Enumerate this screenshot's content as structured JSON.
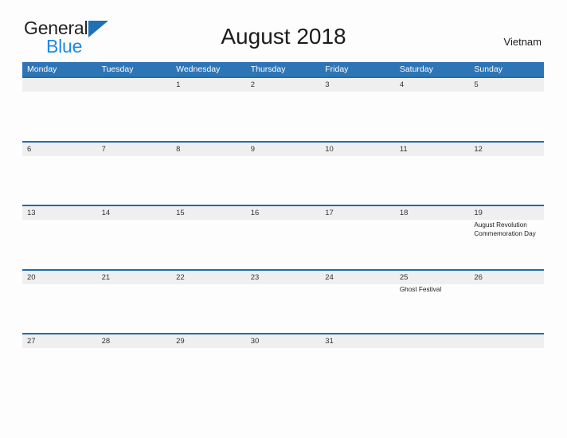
{
  "brand": {
    "name_line1": "General",
    "name_line2": "Blue",
    "mark": "triangle-flag"
  },
  "header": {
    "title": "August 2018",
    "country": "Vietnam"
  },
  "colors": {
    "header_blue": "#2e75b6",
    "rule_blue": "#1f6cb0",
    "date_band": "#efefef",
    "brand_blue": "#1e88e5",
    "page_background": "#fdfdfd"
  },
  "calendar": {
    "weekdays": [
      "Monday",
      "Tuesday",
      "Wednesday",
      "Thursday",
      "Friday",
      "Saturday",
      "Sunday"
    ],
    "weeks": [
      {
        "days": [
          {
            "date": "",
            "events": []
          },
          {
            "date": "",
            "events": []
          },
          {
            "date": "1",
            "events": []
          },
          {
            "date": "2",
            "events": []
          },
          {
            "date": "3",
            "events": []
          },
          {
            "date": "4",
            "events": []
          },
          {
            "date": "5",
            "events": []
          }
        ]
      },
      {
        "days": [
          {
            "date": "6",
            "events": []
          },
          {
            "date": "7",
            "events": []
          },
          {
            "date": "8",
            "events": []
          },
          {
            "date": "9",
            "events": []
          },
          {
            "date": "10",
            "events": []
          },
          {
            "date": "11",
            "events": []
          },
          {
            "date": "12",
            "events": []
          }
        ]
      },
      {
        "days": [
          {
            "date": "13",
            "events": []
          },
          {
            "date": "14",
            "events": []
          },
          {
            "date": "15",
            "events": []
          },
          {
            "date": "16",
            "events": []
          },
          {
            "date": "17",
            "events": []
          },
          {
            "date": "18",
            "events": []
          },
          {
            "date": "19",
            "events": [
              "August Revolution Commemoration Day"
            ]
          }
        ]
      },
      {
        "days": [
          {
            "date": "20",
            "events": []
          },
          {
            "date": "21",
            "events": []
          },
          {
            "date": "22",
            "events": []
          },
          {
            "date": "23",
            "events": []
          },
          {
            "date": "24",
            "events": []
          },
          {
            "date": "25",
            "events": [
              "Ghost Festival"
            ]
          },
          {
            "date": "26",
            "events": []
          }
        ]
      },
      {
        "days": [
          {
            "date": "27",
            "events": []
          },
          {
            "date": "28",
            "events": []
          },
          {
            "date": "29",
            "events": []
          },
          {
            "date": "30",
            "events": []
          },
          {
            "date": "31",
            "events": []
          },
          {
            "date": "",
            "events": []
          },
          {
            "date": "",
            "events": []
          }
        ]
      }
    ]
  }
}
